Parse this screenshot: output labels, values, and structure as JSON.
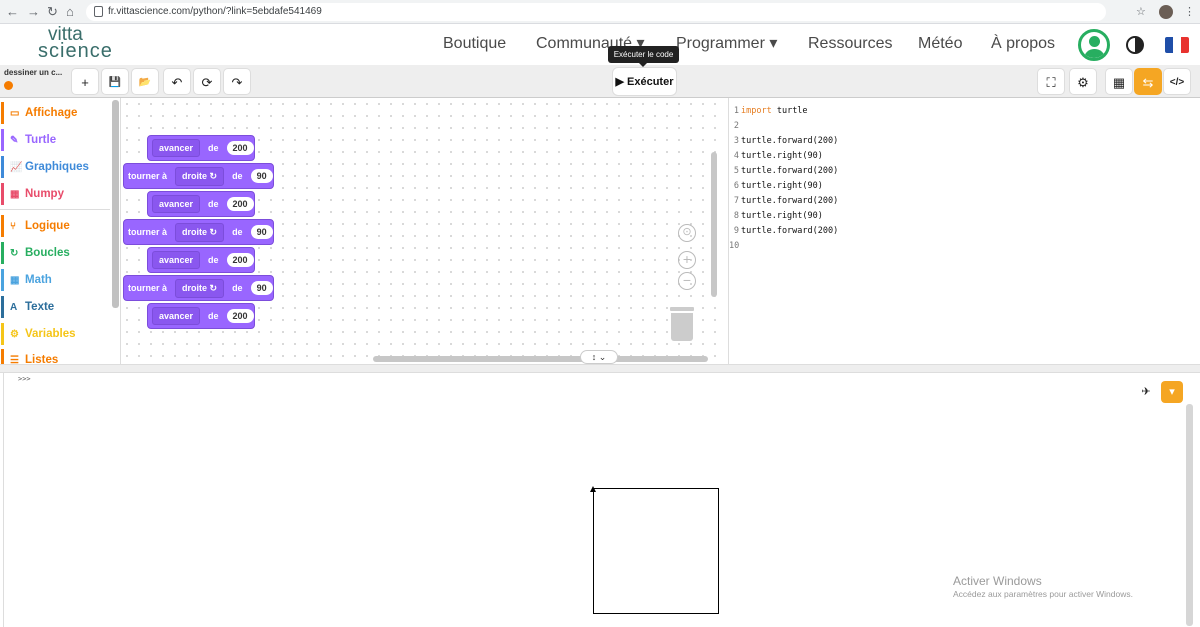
{
  "browser": {
    "url": "fr.vittascience.com/python/?link=5ebdafe541469",
    "back_icon": "←",
    "forward_icon": "→",
    "reload_icon": "↻",
    "home_icon": "⌂",
    "star_icon": "☆",
    "menu_icon": "⋮"
  },
  "header": {
    "logo_top": "vitta",
    "logo_bottom": "science",
    "nav": [
      "Boutique",
      "Communauté ▾",
      "Programmer ▾",
      "Ressources",
      "Météo",
      "À propos"
    ]
  },
  "toolbar": {
    "project_name": "dessiner un c...",
    "new_icon": "+",
    "save_icon": "💾",
    "open_icon": "📂",
    "undo_icon": "↶",
    "refresh_icon": "⟳",
    "redo_icon": "↷",
    "run_label": "▶ Exécuter",
    "run_tooltip": "Exécuter le code",
    "fullscreen_icon": "⛶",
    "settings_icon": "⚙",
    "blocks_icon": "▦",
    "split_icon": "⇆",
    "code_icon": "</>"
  },
  "sidebar": {
    "categories": [
      {
        "label": "Affichage",
        "icon": "▭",
        "color": "#f57c00"
      },
      {
        "label": "Turtle",
        "icon": "✎",
        "color": "#9966ff"
      },
      {
        "label": "Graphiques",
        "icon": "📈",
        "color": "#3e8ad9"
      },
      {
        "label": "Numpy",
        "icon": "▦",
        "color": "#e84c6a"
      },
      {
        "label": "Logique",
        "icon": "⑂",
        "color": "#f57c00"
      },
      {
        "label": "Boucles",
        "icon": "↻",
        "color": "#27ae60"
      },
      {
        "label": "Math",
        "icon": "▦",
        "color": "#4aa3df"
      },
      {
        "label": "Texte",
        "icon": "A",
        "color": "#2c6e9b"
      },
      {
        "label": "Variables",
        "icon": "⚙",
        "color": "#f5c518"
      },
      {
        "label": "Listes",
        "icon": "☰",
        "color": "#f57c00"
      }
    ]
  },
  "blocks": [
    {
      "type": "avancer",
      "label": "avancer",
      "de": "de",
      "value": "200"
    },
    {
      "type": "tourner",
      "label": "tourner à",
      "dir": "droite ↻",
      "de": "de",
      "value": "90"
    },
    {
      "type": "avancer",
      "label": "avancer",
      "de": "de",
      "value": "200"
    },
    {
      "type": "tourner",
      "label": "tourner à",
      "dir": "droite ↻",
      "de": "de",
      "value": "90"
    },
    {
      "type": "avancer",
      "label": "avancer",
      "de": "de",
      "value": "200"
    },
    {
      "type": "tourner",
      "label": "tourner à",
      "dir": "droite ↻",
      "de": "de",
      "value": "90"
    },
    {
      "type": "avancer",
      "label": "avancer",
      "de": "de",
      "value": "200"
    }
  ],
  "workspace": {
    "recenter_icon": "⊙",
    "zoom_in_icon": "+",
    "zoom_out_icon": "−",
    "resize_icon": "↕ ⌄"
  },
  "code": {
    "lines": [
      {
        "n": "1",
        "kw": "import",
        "rest": " turtle"
      },
      {
        "n": "2",
        "kw": "",
        "rest": ""
      },
      {
        "n": "3",
        "kw": "",
        "rest": "turtle.forward(200)"
      },
      {
        "n": "4",
        "kw": "",
        "rest": "turtle.right(90)"
      },
      {
        "n": "5",
        "kw": "",
        "rest": "turtle.forward(200)"
      },
      {
        "n": "6",
        "kw": "",
        "rest": "turtle.right(90)"
      },
      {
        "n": "7",
        "kw": "",
        "rest": "turtle.forward(200)"
      },
      {
        "n": "8",
        "kw": "",
        "rest": "turtle.right(90)"
      },
      {
        "n": "9",
        "kw": "",
        "rest": "turtle.forward(200)"
      },
      {
        "n": "10",
        "kw": "",
        "rest": ""
      }
    ]
  },
  "console": {
    "prompt": ">>>",
    "pin_icon": "✈",
    "collapse_icon": "▾"
  },
  "watermark": {
    "title": "Activer Windows",
    "subtitle": "Accédez aux paramètres pour activer Windows."
  }
}
